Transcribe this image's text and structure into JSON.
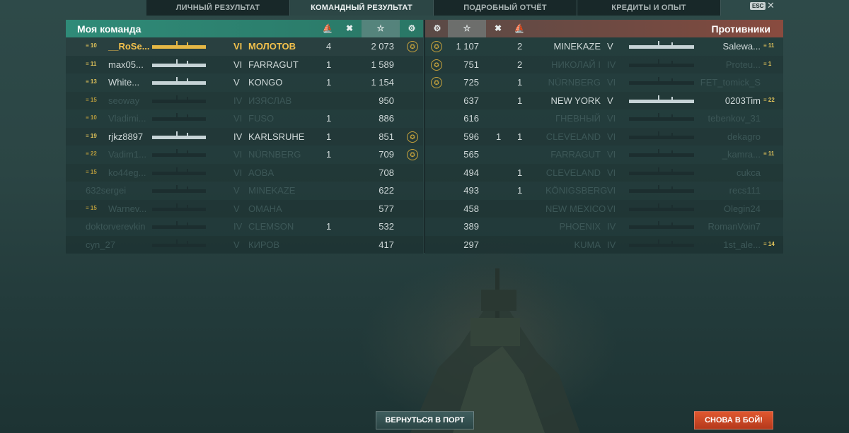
{
  "tabs": [
    "ЛИЧНЫЙ РЕЗУЛЬТАТ",
    "КОМАНДНЫЙ РЕЗУЛЬТАТ",
    "ПОДРОБНЫЙ ОТЧЁТ",
    "КРЕДИТЫ И ОПЫТ"
  ],
  "active_tab": "КОМАНДНЫЙ РЕЗУЛЬТАТ",
  "esc_label": "ESC",
  "close_glyph": "✕",
  "my_team": {
    "title": "Моя команда",
    "header_icons": [
      "ship-hit-icon",
      "kills-icon",
      "xp-star-icon",
      "medal-icon"
    ],
    "rows": [
      {
        "rank": "10",
        "player": "__RoSe...",
        "tier": "VI",
        "ship": "МОЛОТОВ",
        "kills": "4",
        "xp": "2 073",
        "medal": true,
        "me": true
      },
      {
        "rank": "11",
        "player": "max05...",
        "tier": "VI",
        "ship": "FARRAGUT",
        "kills": "1",
        "xp": "1 589",
        "medal": false
      },
      {
        "rank": "13",
        "player": "White...",
        "tier": "V",
        "ship": "KONGO",
        "kills": "1",
        "xp": "1 154",
        "medal": false
      },
      {
        "rank": "15",
        "player": "seoway",
        "tier": "IV",
        "ship": "ИЗЯСЛАВ",
        "kills": "",
        "xp": "950",
        "medal": false
      },
      {
        "rank": "10",
        "player": "Vladimi...",
        "tier": "VI",
        "ship": "FUSO",
        "kills": "1",
        "xp": "886",
        "medal": false
      },
      {
        "rank": "19",
        "player": "rjkz8897",
        "tier": "IV",
        "ship": "KARLSRUHE",
        "kills": "1",
        "xp": "851",
        "medal": true
      },
      {
        "rank": "22",
        "player": "Vadim1...",
        "tier": "VI",
        "ship": "NÜRNBERG",
        "kills": "1",
        "xp": "709",
        "medal": true
      },
      {
        "rank": "15",
        "player": "ko44eg...",
        "tier": "VI",
        "ship": "AOBA",
        "kills": "",
        "xp": "708",
        "medal": false
      },
      {
        "rank": "",
        "player": "632sergei",
        "tier": "V",
        "ship": "MINEKAZE",
        "kills": "",
        "xp": "622",
        "medal": false
      },
      {
        "rank": "15",
        "player": "Warnev...",
        "tier": "V",
        "ship": "OMAHA",
        "kills": "",
        "xp": "577",
        "medal": false
      },
      {
        "rank": "",
        "player": "doktorverevkin",
        "tier": "IV",
        "ship": "CLEMSON",
        "kills": "1",
        "xp": "532",
        "medal": false
      },
      {
        "rank": "",
        "player": "cyn_27",
        "tier": "V",
        "ship": "КИРОВ",
        "kills": "",
        "xp": "417",
        "medal": false
      }
    ]
  },
  "enemy_team": {
    "title": "Противники",
    "header_icons": [
      "medal-icon",
      "xp-star-icon",
      "kills-icon",
      "ship-hit-icon"
    ],
    "rows": [
      {
        "medal": true,
        "xp": "1 107",
        "planes": "",
        "kills": "2",
        "ship": "MINEKAZE",
        "tier": "V",
        "player": "Salewa...",
        "rank": "11"
      },
      {
        "medal": true,
        "xp": "751",
        "planes": "",
        "kills": "2",
        "ship": "НИКОЛАЙ I",
        "tier": "IV",
        "player": "Proteu...",
        "rank": "1"
      },
      {
        "medal": true,
        "xp": "725",
        "planes": "",
        "kills": "1",
        "ship": "NÜRNBERG",
        "tier": "VI",
        "player": "FET_tomick_S",
        "rank": ""
      },
      {
        "medal": false,
        "xp": "637",
        "planes": "",
        "kills": "1",
        "ship": "NEW YORK",
        "tier": "V",
        "player": "0203Tim",
        "rank": "22"
      },
      {
        "medal": false,
        "xp": "616",
        "planes": "",
        "kills": "",
        "ship": "ГНЕВНЫЙ",
        "tier": "VI",
        "player": "tebenkov_31",
        "rank": ""
      },
      {
        "medal": false,
        "xp": "596",
        "planes": "1",
        "kills": "1",
        "ship": "CLEVELAND",
        "tier": "VI",
        "player": "dekagro",
        "rank": ""
      },
      {
        "medal": false,
        "xp": "565",
        "planes": "",
        "kills": "",
        "ship": "FARRAGUT",
        "tier": "VI",
        "player": "_kamra...",
        "rank": "11"
      },
      {
        "medal": false,
        "xp": "494",
        "planes": "",
        "kills": "1",
        "ship": "CLEVELAND",
        "tier": "VI",
        "player": "cukca",
        "rank": ""
      },
      {
        "medal": false,
        "xp": "493",
        "planes": "",
        "kills": "1",
        "ship": "KÖNIGSBERG",
        "tier": "VI",
        "player": "recs111",
        "rank": ""
      },
      {
        "medal": false,
        "xp": "458",
        "planes": "",
        "kills": "",
        "ship": "NEW MEXICO",
        "tier": "VI",
        "player": "Olegin24",
        "rank": ""
      },
      {
        "medal": false,
        "xp": "389",
        "planes": "",
        "kills": "",
        "ship": "PHOENIX",
        "tier": "IV",
        "player": "RomanVoin7",
        "rank": ""
      },
      {
        "medal": false,
        "xp": "297",
        "planes": "",
        "kills": "",
        "ship": "KUMA",
        "tier": "IV",
        "player": "1st_ale...",
        "rank": "14"
      }
    ]
  },
  "buttons": {
    "port": "ВЕРНУТЬСЯ В ПОРТ",
    "battle": "СНОВА В БОЙ!"
  },
  "colors": {
    "highlight": "#f2c14c",
    "my_team_header": "#2f8b78",
    "enemy_header": "#8a4b3f",
    "battle_button": "#d24a26"
  }
}
